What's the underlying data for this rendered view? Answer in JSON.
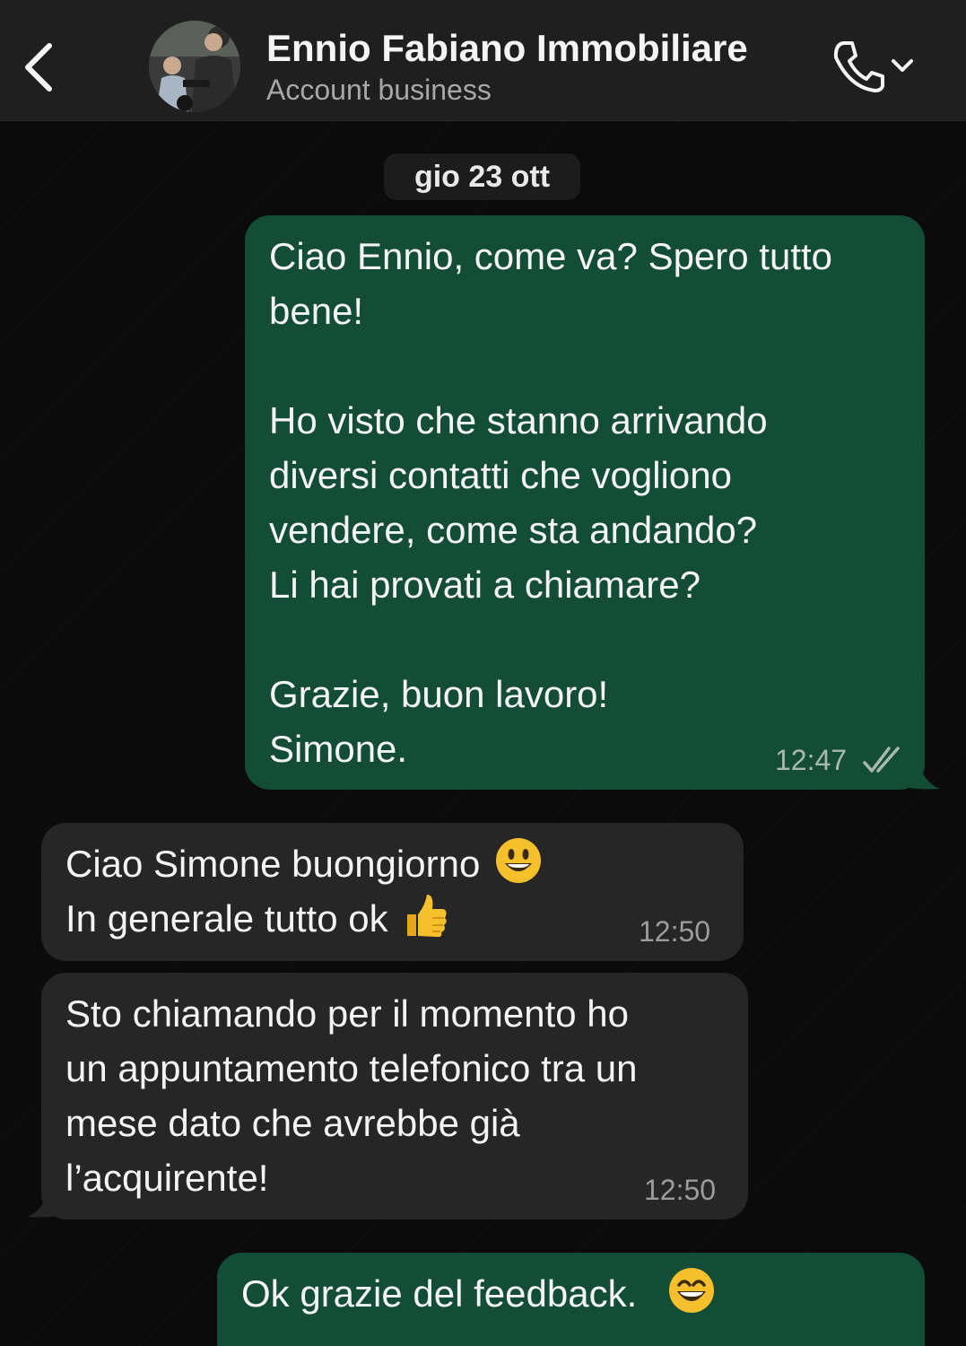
{
  "header": {
    "contact_name": "Ennio Fabiano Immobiliare",
    "contact_subtitle": "Account business",
    "icons": [
      "back-chevron-icon",
      "avatar-photo",
      "phone-icon",
      "chevron-down-icon"
    ]
  },
  "date_separator": "gio 23 ott",
  "messages": [
    {
      "direction": "outgoing",
      "text": "Ciao Ennio, come va? Spero tutto\nbene!\n\nHo visto che stanno arrivando\ndiversi contatti che vogliono\nvendere, come sta andando?\nLi hai provati a chiamare?\n\nGrazie, buon lavoro!\nSimone.",
      "time": "12:47",
      "status": "read"
    },
    {
      "direction": "incoming",
      "line1": "Ciao Simone buongiorno",
      "line1_emoji": "grinning-face-emoji",
      "line2": "In generale tutto ok",
      "line2_emoji": "thumbs-up-emoji",
      "time": "12:50"
    },
    {
      "direction": "incoming",
      "text": "Sto chiamando per il momento ho\nun appuntamento telefonico tra un\nmese dato che avrebbe già\nl’acquirente!",
      "time": "12:50"
    },
    {
      "direction": "outgoing",
      "text": "Ok grazie del feedback.",
      "emoji": "grinning-face-with-smiling-eyes-emoji"
    }
  ],
  "colors": {
    "header_bg": "#1f1f1f",
    "chat_bg": "#0b0b0b",
    "outgoing_bubble": "#144d37",
    "incoming_bubble": "#262626"
  }
}
